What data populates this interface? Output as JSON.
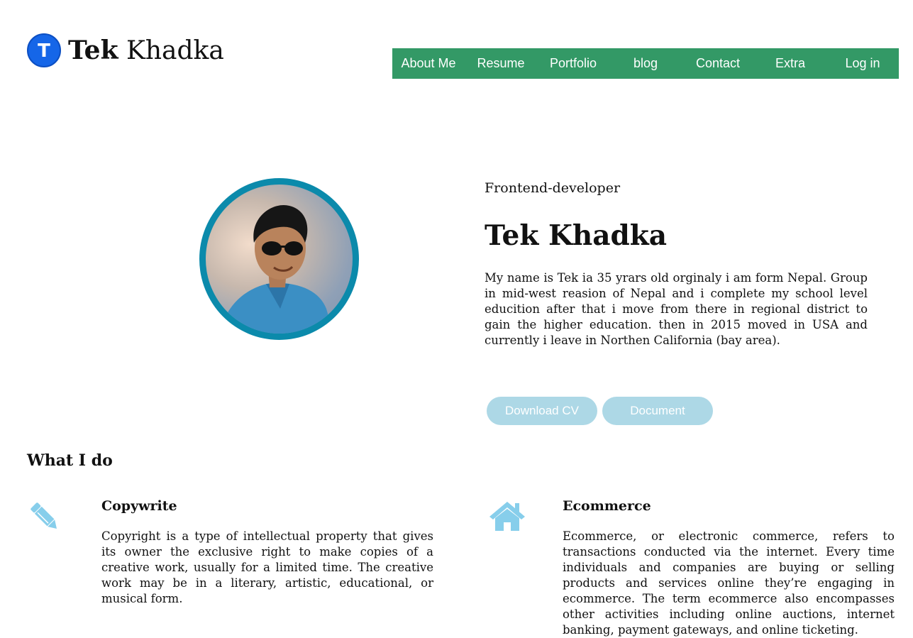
{
  "brand": {
    "logo_letter": "T",
    "first": "Tek",
    "last": "Khadka"
  },
  "nav": {
    "items": [
      {
        "label": "About Me"
      },
      {
        "label": "Resume"
      },
      {
        "label": "Portfolio"
      },
      {
        "label": "blog"
      },
      {
        "label": "Contact"
      },
      {
        "label": "Extra"
      },
      {
        "label": "Log in"
      }
    ]
  },
  "hero": {
    "role": "Frontend-developer",
    "name": "Tek Khadka",
    "bio": "My name is Tek ia 35 yrars old orginaly i am form Nepal. Group in mid-west reasion of Nepal and i complete my school level educition after that i move from there in regional district to gain the higher education. then in 2015 moved in USA and currently i leave in Northen California (bay area).",
    "buttons": {
      "download_cv": "Download CV",
      "document": "Document"
    }
  },
  "services": {
    "title": "What I do",
    "items": [
      {
        "icon": "pencil-icon",
        "title": "Copywrite",
        "text": "Copyright is a type of intellectual property that gives its owner the exclusive right to make copies of a creative work, usually for a limited time. The creative work may be in a literary, artistic, educational, or musical form."
      },
      {
        "icon": "home-icon",
        "title": "Ecommerce",
        "text": "Ecommerce, or electronic commerce, refers to transactions conducted via the internet. Every time individuals and companies are buying or selling products and services online they’re engaging in ecommerce. The term ecommerce also encompasses other activities including online auctions, internet banking, payment gateways, and online ticketing."
      }
    ]
  },
  "colors": {
    "nav_bg": "#339966",
    "logo_blue": "#1566e8",
    "avatar_ring": "#0b8aab",
    "button_bg": "#add8e6",
    "icon_color": "#87ceeb"
  }
}
